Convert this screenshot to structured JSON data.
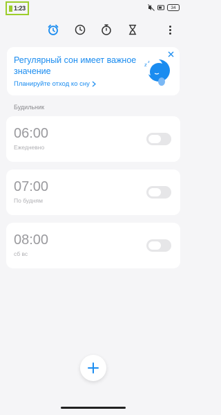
{
  "status_bar": {
    "time": "1:23",
    "battery": "34"
  },
  "tabs": [
    {
      "name": "alarm",
      "icon": "alarm-clock-icon",
      "active": true
    },
    {
      "name": "clock",
      "icon": "clock-icon",
      "active": false
    },
    {
      "name": "stopwatch",
      "icon": "stopwatch-icon",
      "active": false
    },
    {
      "name": "timer",
      "icon": "hourglass-icon",
      "active": false
    }
  ],
  "promo": {
    "title": "Регулярный сон имеет важное значение",
    "link": "Планируйте отход ко сну",
    "illustration": "sleeping-moon-icon"
  },
  "section_label": "Будильник",
  "alarms": [
    {
      "time": "06:00",
      "repeat": "Ежедневно",
      "enabled": false
    },
    {
      "time": "07:00",
      "repeat": "По будням",
      "enabled": false
    },
    {
      "time": "08:00",
      "repeat": "сб вс",
      "enabled": false
    }
  ],
  "colors": {
    "accent": "#1a8cf0",
    "background": "#f5f5f7",
    "card": "#ffffff",
    "muted_text": "#9a9a9e"
  }
}
